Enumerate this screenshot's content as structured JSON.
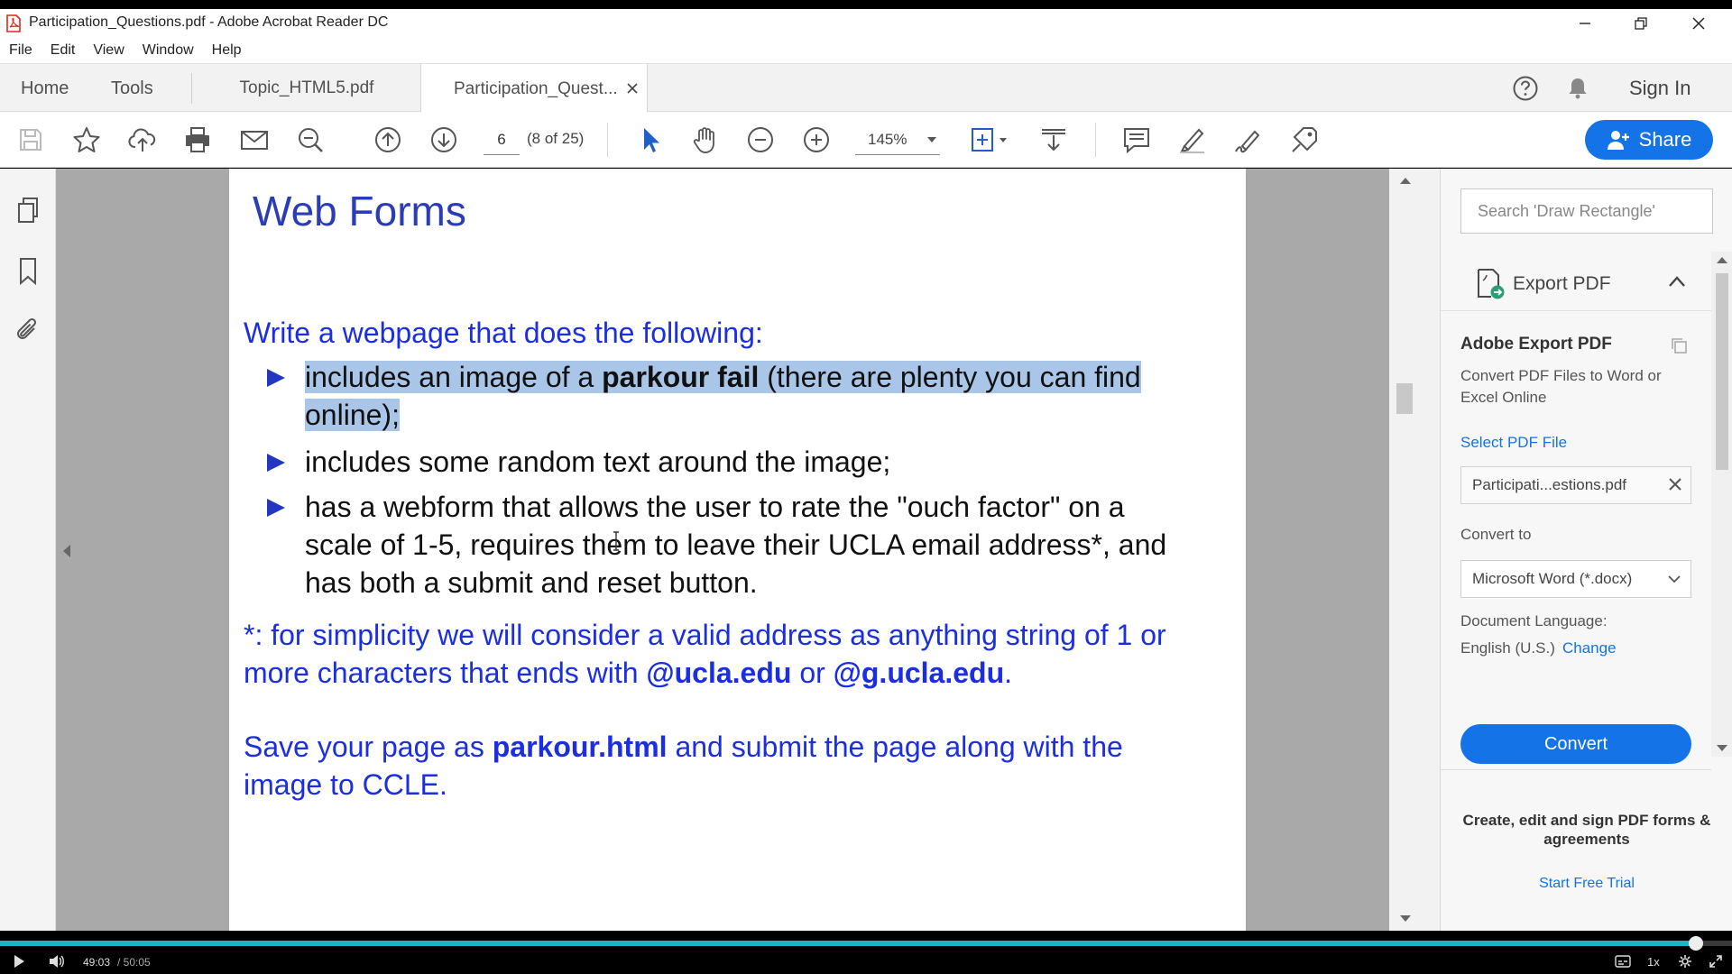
{
  "window": {
    "title": "Participation_Questions.pdf - Adobe Acrobat Reader DC"
  },
  "menu": [
    "File",
    "Edit",
    "View",
    "Window",
    "Help"
  ],
  "tabs": {
    "home": "Home",
    "tools": "Tools",
    "doc1": "Topic_HTML5.pdf",
    "doc2": "Participation_Quest...",
    "sign_in": "Sign In"
  },
  "toolbar": {
    "page_number": "6",
    "page_count": "(8 of 25)",
    "zoom": "145%",
    "share": "Share"
  },
  "document": {
    "heading": "Web Forms",
    "intro": "Write a webpage that does the following:",
    "bullets": {
      "b1_a": "includes an image of a ",
      "b1_bold": "parkour fail",
      "b1_b": " (there are plenty you can find",
      "b1_c": "online);",
      "b2": "includes some random text around the image;",
      "b3_l1": "has a webform that allows the user to rate the \"ouch factor\" on a",
      "b3_l2": "scale of 1-5, requires them to leave their UCLA email address*, and",
      "b3_l3": "has both a submit and reset button."
    },
    "note": {
      "l1": "*: for simplicity we will consider a valid address as anything string of 1 or",
      "l2_a": "more characters that ends with ",
      "l2_b1": "@ucla.edu",
      "l2_mid": " or ",
      "l2_b2": "@g.ucla.edu",
      "l2_end": "."
    },
    "save": {
      "a": "Save your page as ",
      "bold": "parkour.html",
      "b": " and submit the page along with the",
      "c": "image to CCLE."
    }
  },
  "right_panel": {
    "search_placeholder": "Search 'Draw Rectangle'",
    "export_header": "Export PDF",
    "export_title": "Adobe Export PDF",
    "export_desc": "Convert PDF Files to Word or Excel Online",
    "select_file": "Select PDF File",
    "file_name": "Participati...estions.pdf",
    "convert_to_label": "Convert to",
    "convert_to_value": "Microsoft Word (*.docx)",
    "doc_language_label": "Document Language:",
    "doc_language_value": "English (U.S.)",
    "change": "Change",
    "convert_button": "Convert",
    "promo": "Create, edit and sign PDF forms & agreements",
    "trial": "Start Free Trial"
  },
  "player": {
    "current_time": "49:03",
    "duration": "/ 50:05",
    "speed": "1x",
    "progress": 0.979
  },
  "colors": {
    "accent": "#1473e6",
    "heading": "#2a3cb8",
    "body_blue": "#1b2ee0",
    "highlight": "#a9c6e8",
    "progress": "#23b0c9"
  },
  "icons": [
    "pdf-app-icon",
    "minimize-icon",
    "restore-icon",
    "close-icon",
    "help-icon",
    "bell-icon",
    "save-icon",
    "star-icon",
    "upload-icon",
    "print-icon",
    "mail-icon",
    "search-zoom-icon",
    "page-up-icon",
    "page-down-icon",
    "select-cursor-icon",
    "hand-icon",
    "zoom-out-icon",
    "zoom-in-icon",
    "fit-page-icon",
    "scroll-mode-icon",
    "comment-icon",
    "highlight-pen-icon",
    "sign-icon",
    "stamp-icon",
    "share-user-icon",
    "pages-icon",
    "bookmark-icon",
    "attachment-icon",
    "export-pdf-icon",
    "chevron-up-icon",
    "copy-icon",
    "clear-icon",
    "chevron-down-icon",
    "play-icon",
    "volume-icon",
    "captions-icon",
    "settings-icon",
    "fullscreen-icon"
  ]
}
